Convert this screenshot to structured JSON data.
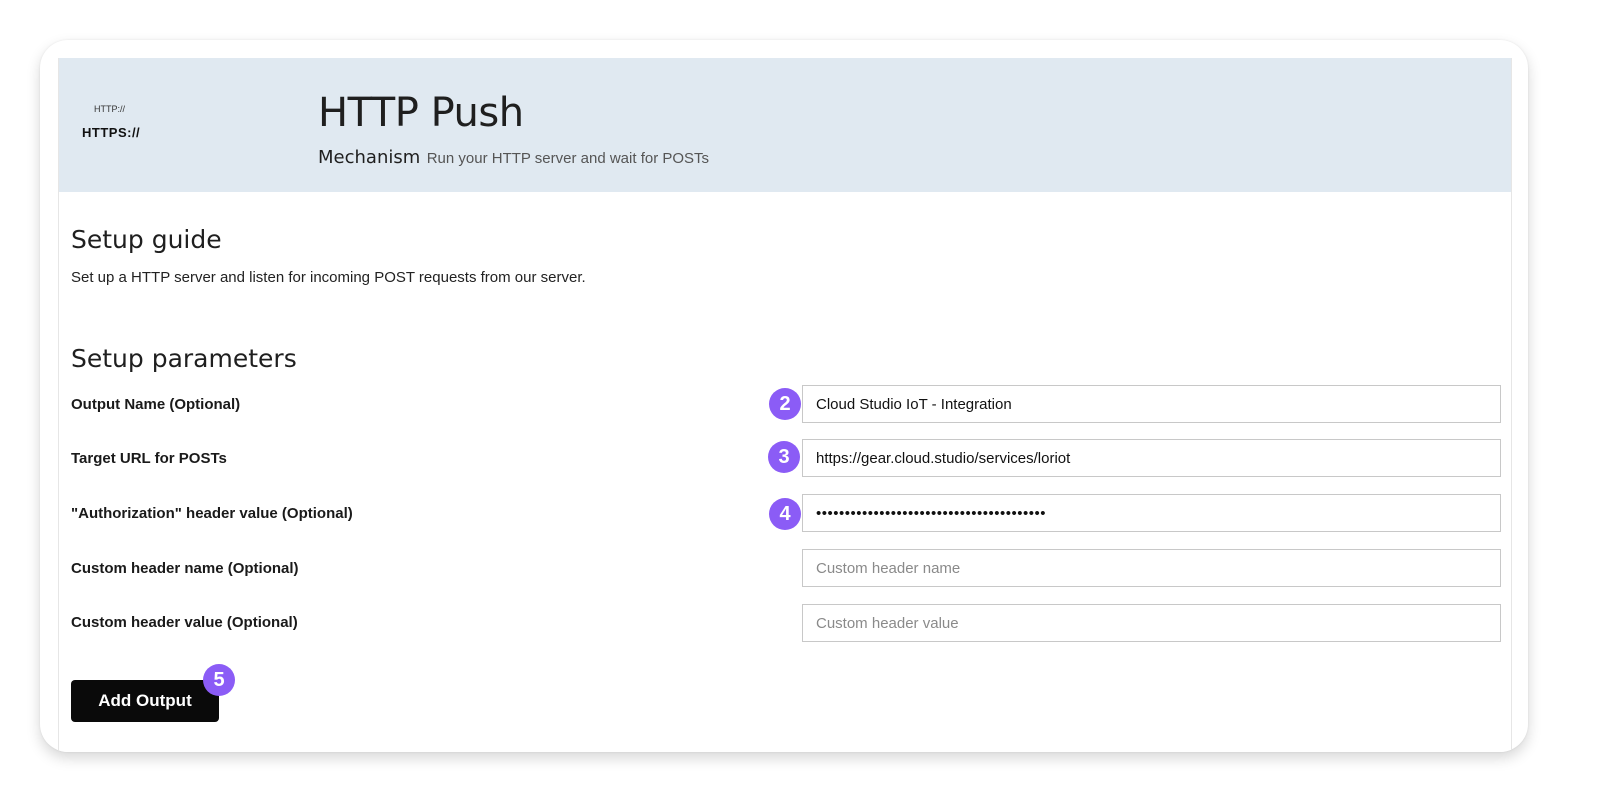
{
  "header": {
    "logo_small": "HTTP://",
    "logo_big": "HTTPS://",
    "title": "HTTP Push",
    "mechanism_label": "Mechanism",
    "mechanism_desc": "Run your HTTP server and wait for POSTs"
  },
  "guide": {
    "title": "Setup guide",
    "text": "Set up a HTTP server and listen for incoming POST requests from our server."
  },
  "params": {
    "title": "Setup parameters",
    "output_name": {
      "label": "Output Name (Optional)",
      "value": "Cloud Studio IoT - Integration",
      "placeholder": "",
      "step": "2"
    },
    "target_url": {
      "label": "Target URL for POSTs",
      "value": "https://gear.cloud.studio/services/loriot",
      "placeholder": "",
      "step": "3"
    },
    "authorization": {
      "label": "\"Authorization\" header value (Optional)",
      "value": "••••••••••••••••••••••••••••••••••••••••",
      "placeholder": "",
      "step": "4"
    },
    "custom_header_name": {
      "label": "Custom header name (Optional)",
      "value": "",
      "placeholder": "Custom header name"
    },
    "custom_header_value": {
      "label": "Custom header value (Optional)",
      "value": "",
      "placeholder": "Custom header value"
    }
  },
  "actions": {
    "add_output_label": "Add Output",
    "add_output_step": "5"
  },
  "colors": {
    "header_bg": "#e0e9f1",
    "badge": "#8b5cf6",
    "button_bg": "#0a0a0a"
  }
}
